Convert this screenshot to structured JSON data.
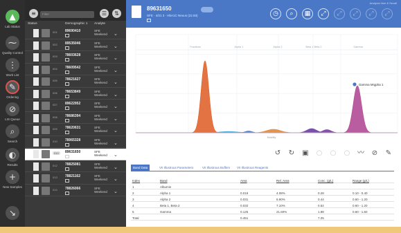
{
  "rail": [
    {
      "label": "Lab Status",
      "icon": "▲",
      "style": "green"
    },
    {
      "label": "Quality Control",
      "icon": "⁓",
      "style": ""
    },
    {
      "label": "Work List",
      "icon": "⋮",
      "style": ""
    },
    {
      "label": "Ordering",
      "icon": "✎",
      "style": "active"
    },
    {
      "label": "LIS Queue",
      "icon": "⊘",
      "style": ""
    },
    {
      "label": "Search",
      "icon": "⌕",
      "style": ""
    },
    {
      "label": "Results",
      "icon": "◐",
      "style": ""
    },
    {
      "label": "New Samples",
      "icon": "+",
      "style": ""
    },
    {
      "label": "",
      "icon": "↘",
      "style": ""
    }
  ],
  "list": {
    "filter_placeholder": "Filter",
    "columns": {
      "status": "Status",
      "demographic": "Demographic 1",
      "analyte": "Analyte"
    },
    "rows": [
      {
        "num": "001",
        "id": "89690410",
        "test": "SFE\nWeekend"
      },
      {
        "num": "002",
        "id": "89535046",
        "test": "SFE\nWeekend"
      },
      {
        "num": "003",
        "id": "78603628",
        "test": "SFE\nWeekend"
      },
      {
        "num": "004",
        "id": "78609542",
        "test": "SFE\nWeekend"
      },
      {
        "num": "005",
        "id": "78621627",
        "test": "SFE\nWeekend"
      },
      {
        "num": "006",
        "id": "78653849",
        "test": "SFE\nWeekend"
      },
      {
        "num": "007",
        "id": "89622952",
        "test": "SFE\nWeekend"
      },
      {
        "num": "008",
        "id": "78686394",
        "test": "SFE\nWeekend"
      },
      {
        "num": "009",
        "id": "78620631",
        "test": "SFE\nWeekend"
      },
      {
        "num": "010",
        "id": "78965328",
        "test": "SFE\nWeekend"
      },
      {
        "num": "010",
        "id": "89631650",
        "test": "SFE\nWeekend",
        "selected": true
      },
      {
        "num": "012",
        "id": "78825081",
        "test": "SFE\nWeekend"
      },
      {
        "num": "013",
        "id": "78821162",
        "test": "SFE\nWeekend"
      },
      {
        "num": "014",
        "id": "78826066",
        "test": "SFE\nWeekend"
      }
    ]
  },
  "header": {
    "title": "89631650",
    "subtitle": "SFE · 4/21 3 · HbA1C Neuus (22.93)",
    "top_right": "Analyzer fare & Sevall",
    "icons": [
      "clock-icon",
      "search-icon",
      "chart-icon",
      "expand-icon",
      "expand-icon",
      "expand-icon",
      "expand-icon",
      "expand-icon"
    ]
  },
  "chart_data": {
    "type": "area",
    "region_labels": [
      "Fractions",
      "Alpha 1",
      "Alpha 2",
      "Beta 1 Beta 2",
      "Gamma"
    ],
    "x": [
      0,
      10,
      20,
      30,
      40,
      50,
      60,
      70,
      80,
      90,
      100
    ],
    "series": [
      {
        "name": "Albumin",
        "color": "#e0642d"
      },
      {
        "name": "Alpha 1",
        "color": "#4a78c7"
      },
      {
        "name": "Alpha 2",
        "color": "#e0642d"
      },
      {
        "name": "Beta",
        "color": "#7a3fa0"
      },
      {
        "name": "Gamma",
        "color": "#b24a96"
      }
    ],
    "annotation": "Gamma Mrgpha 1",
    "xlabel": "Mobility",
    "grid": true
  },
  "toolbar": {
    "icons": [
      "↺",
      "↻",
      "▣",
      "○",
      "○",
      "○",
      "〰",
      "⊘",
      "✎"
    ]
  },
  "tabs": [
    "Band Data",
    "VII Illustrous Parameters",
    "VII Illustrous Buffers",
    "VII Illustrous Reagents"
  ],
  "table": {
    "headers": [
      "Index",
      "Band",
      "Area",
      "Rel. Area",
      "Conc. (g/L)",
      "Range (g/L)"
    ],
    "rows": [
      [
        "1",
        "Albumin",
        "",
        "",
        "",
        ""
      ],
      [
        "2",
        "Alpha 1",
        "0.019",
        "4.08%",
        "0.28",
        "0.10 - 0.40"
      ],
      [
        "3",
        "Alpha 2",
        "0.031",
        "6.90%",
        "0.44",
        "0.60 - 1.20"
      ],
      [
        "4",
        "Beta 1, Beta 2",
        "0.032",
        "7.10%",
        "0.52",
        "0.60 - 1.20"
      ],
      [
        "5",
        "Gamma",
        "0.125",
        "21.60%",
        "1.88",
        "0.60 - 1.60"
      ],
      [
        "Total",
        "",
        "0.451",
        "",
        "7.25",
        ""
      ]
    ]
  },
  "colors": {
    "accent": "#4a78c7",
    "rail": "#2e2e2e",
    "list": "#3a3a3a",
    "footer": "#f0c87a"
  }
}
